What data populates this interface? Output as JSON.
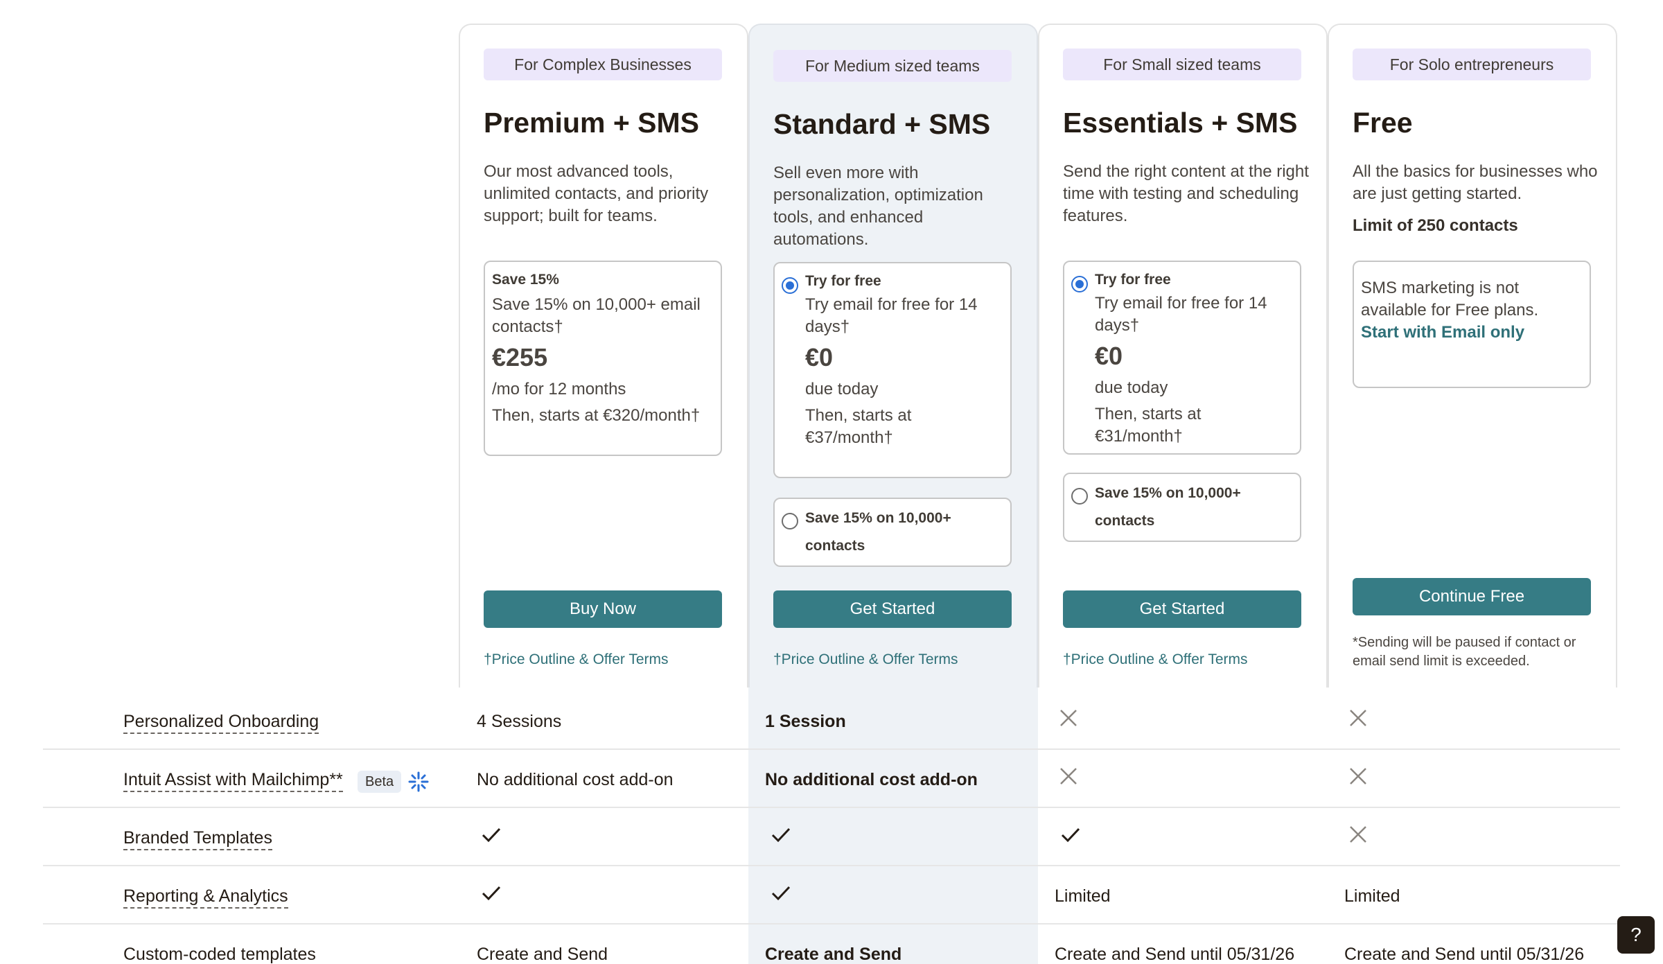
{
  "plans": [
    {
      "badge": "For Complex Businesses",
      "title": "Premium + SMS",
      "description": "Our most advanced tools, unlimited contacts, and priority support; built for teams.",
      "offer": {
        "label": "Save 15%",
        "detail": "Save 15% on 10,000+ email contacts†",
        "price": "€255",
        "period": "/mo for 12 months",
        "then": "Then, starts at €320/month†"
      },
      "cta": "Buy Now",
      "terms": "†Price Outline & Offer Terms"
    },
    {
      "badge": "For Medium sized teams",
      "title": "Standard + SMS",
      "description": "Sell even more with personalization, optimization tools, and enhanced automations.",
      "offer": {
        "label": "Try for free",
        "detail": "Try email for free for 14 days†",
        "price": "€0",
        "period": "due today",
        "then": "Then, starts at €37/month†"
      },
      "alt_offer": "Save 15% on 10,000+ contacts",
      "cta": "Get Started",
      "terms": "†Price Outline & Offer Terms"
    },
    {
      "badge": "For Small sized teams",
      "title": "Essentials + SMS",
      "description": "Send the right content at the right time with testing and scheduling features.",
      "offer": {
        "label": "Try for free",
        "detail": "Try email for free for 14 days†",
        "price": "€0",
        "period": "due today",
        "then": "Then, starts at €31/month†"
      },
      "alt_offer": "Save 15% on 10,000+ contacts",
      "cta": "Get Started",
      "terms": "†Price Outline & Offer Terms"
    },
    {
      "badge": "For Solo entrepreneurs",
      "title": "Free",
      "description": "All the basics for businesses who are just getting started.",
      "limit": "Limit of 250 contacts",
      "notice": "SMS marketing is not available for Free plans.",
      "notice_link": "Start with Email only",
      "cta": "Continue Free",
      "footnote": "*Sending will be paused if contact or email send limit is exceeded."
    }
  ],
  "features": [
    {
      "label": "Personalized Onboarding",
      "values": [
        "4 Sessions",
        "1 Session",
        "x-icon",
        "x-icon"
      ]
    },
    {
      "label": "Intuit Assist with Mailchimp**",
      "badge": "Beta",
      "values": [
        "No additional cost add-on",
        "No additional cost add-on",
        "x-icon",
        "x-icon"
      ]
    },
    {
      "label": "Branded Templates",
      "values": [
        "check-icon",
        "check-icon",
        "check-icon",
        "x-icon"
      ]
    },
    {
      "label": "Reporting & Analytics",
      "values": [
        "check-icon",
        "check-icon",
        "Limited",
        "Limited"
      ]
    },
    {
      "label": "Custom-coded templates",
      "values": [
        "Create and Send",
        "Create and Send",
        "Create and Send until 05/31/26",
        "Create and Send until 05/31/26"
      ]
    }
  ],
  "help_button": "?",
  "colors": {
    "accent": "#367c85",
    "badge_bg": "#ece7fb",
    "featured_bg": "#eef2f6",
    "radio": "#2a6fd6"
  }
}
